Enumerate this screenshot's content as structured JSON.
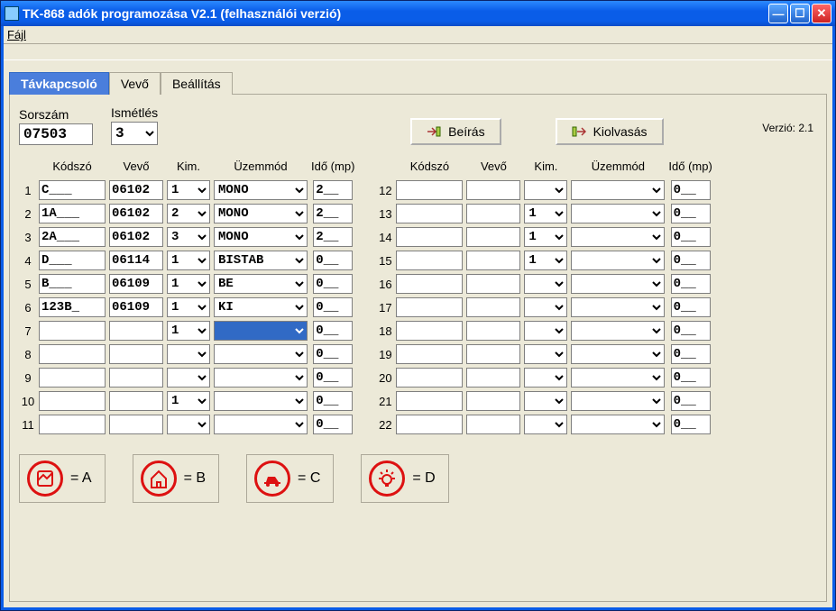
{
  "window": {
    "title": "TK-868 adók programozása V2.1  (felhasználói verzió)"
  },
  "menu": {
    "file": "Fájl"
  },
  "tabs": {
    "t1": "Távkapcsoló",
    "t2": "Vevő",
    "t3": "Beállítás"
  },
  "labels": {
    "sorszam": "Sorszám",
    "ismetles": "Ismétlés",
    "verzio": "Verzió: 2.1"
  },
  "top": {
    "sorszam": "07503",
    "ismetles": "3"
  },
  "buttons": {
    "beiras": "Beírás",
    "kiolvasas": "Kiolvasás"
  },
  "headers": {
    "kodszo": "Kódszó",
    "vevo": "Vevő",
    "kim": "Kim.",
    "uzemmod": "Üzemmód",
    "ido": "Idő (mp)"
  },
  "legend": {
    "a": "= A",
    "b": "= B",
    "c": "= C",
    "d": "= D"
  },
  "rows": [
    {
      "n": 1,
      "kodszo": "C___",
      "vevo": "06102",
      "kim": "1",
      "uzem": "MONO",
      "ido": "2__",
      "hl": false
    },
    {
      "n": 2,
      "kodszo": "1A___",
      "vevo": "06102",
      "kim": "2",
      "uzem": "MONO",
      "ido": "2__",
      "hl": false
    },
    {
      "n": 3,
      "kodszo": "2A___",
      "vevo": "06102",
      "kim": "3",
      "uzem": "MONO",
      "ido": "2__",
      "hl": false
    },
    {
      "n": 4,
      "kodszo": "D___",
      "vevo": "06114",
      "kim": "1",
      "uzem": "BISTAB",
      "ido": "0__",
      "hl": false
    },
    {
      "n": 5,
      "kodszo": "B___",
      "vevo": "06109",
      "kim": "1",
      "uzem": "BE",
      "ido": "0__",
      "hl": false
    },
    {
      "n": 6,
      "kodszo": "123B_",
      "vevo": "06109",
      "kim": "1",
      "uzem": "KI",
      "ido": "0__",
      "hl": false
    },
    {
      "n": 7,
      "kodszo": "",
      "vevo": "",
      "kim": "1",
      "uzem": "",
      "ido": "0__",
      "hl": true
    },
    {
      "n": 8,
      "kodszo": "",
      "vevo": "",
      "kim": "",
      "uzem": "",
      "ido": "0__",
      "hl": false
    },
    {
      "n": 9,
      "kodszo": "",
      "vevo": "",
      "kim": "",
      "uzem": "",
      "ido": "0__",
      "hl": false
    },
    {
      "n": 10,
      "kodszo": "",
      "vevo": "",
      "kim": "1",
      "uzem": "",
      "ido": "0__",
      "hl": false
    },
    {
      "n": 11,
      "kodszo": "",
      "vevo": "",
      "kim": "",
      "uzem": "",
      "ido": "0__",
      "hl": false
    },
    {
      "n": 12,
      "kodszo": "",
      "vevo": "",
      "kim": "",
      "uzem": "",
      "ido": "0__",
      "hl": false
    },
    {
      "n": 13,
      "kodszo": "",
      "vevo": "",
      "kim": "1",
      "uzem": "",
      "ido": "0__",
      "hl": false
    },
    {
      "n": 14,
      "kodszo": "",
      "vevo": "",
      "kim": "1",
      "uzem": "",
      "ido": "0__",
      "hl": false
    },
    {
      "n": 15,
      "kodszo": "",
      "vevo": "",
      "kim": "1",
      "uzem": "",
      "ido": "0__",
      "hl": false
    },
    {
      "n": 16,
      "kodszo": "",
      "vevo": "",
      "kim": "",
      "uzem": "",
      "ido": "0__",
      "hl": false
    },
    {
      "n": 17,
      "kodszo": "",
      "vevo": "",
      "kim": "",
      "uzem": "",
      "ido": "0__",
      "hl": false
    },
    {
      "n": 18,
      "kodszo": "",
      "vevo": "",
      "kim": "",
      "uzem": "",
      "ido": "0__",
      "hl": false
    },
    {
      "n": 19,
      "kodszo": "",
      "vevo": "",
      "kim": "",
      "uzem": "",
      "ido": "0__",
      "hl": false
    },
    {
      "n": 20,
      "kodszo": "",
      "vevo": "",
      "kim": "",
      "uzem": "",
      "ido": "0__",
      "hl": false
    },
    {
      "n": 21,
      "kodszo": "",
      "vevo": "",
      "kim": "",
      "uzem": "",
      "ido": "0__",
      "hl": false
    },
    {
      "n": 22,
      "kodszo": "",
      "vevo": "",
      "kim": "",
      "uzem": "",
      "ido": "0__",
      "hl": false
    }
  ]
}
